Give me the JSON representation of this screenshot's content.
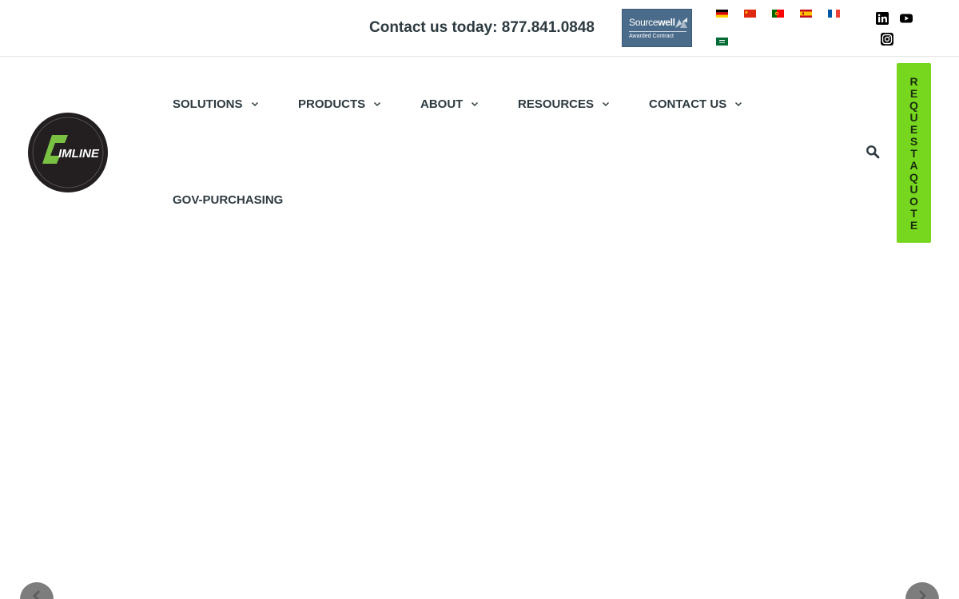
{
  "topbar": {
    "contact_text": "Contact us today: 877.841.0848",
    "sourcewell": {
      "name_light": "Source",
      "name_bold": "well",
      "subtitle": "Awarded Contract"
    },
    "flags": [
      "german-flag",
      "chinese-flag",
      "portuguese-flag",
      "spanish-flag",
      "french-flag",
      "saudi-flag"
    ],
    "social": [
      "linkedin-icon",
      "youtube-icon",
      "instagram-icon"
    ]
  },
  "logo": {
    "text": "IMLINE",
    "accent_color": "#7ac143",
    "disc_color": "#231f20"
  },
  "nav": {
    "items": [
      {
        "label": "SOLUTIONS",
        "has_dropdown": true
      },
      {
        "label": "PRODUCTS",
        "has_dropdown": true
      },
      {
        "label": "ABOUT",
        "has_dropdown": true
      },
      {
        "label": "RESOURCES",
        "has_dropdown": true
      },
      {
        "label": "CONTACT US",
        "has_dropdown": true
      },
      {
        "label": "GOV-PURCHASING",
        "has_dropdown": false
      }
    ],
    "search_icon": "search-icon"
  },
  "quote_button": {
    "letters": [
      "R",
      "E",
      "Q",
      "U",
      "E",
      "S",
      "T",
      "A",
      "Q",
      "U",
      "O",
      "T",
      "E"
    ],
    "color": "#77d71e"
  },
  "slider": {
    "prev_icon": "chevron-left-icon",
    "next_icon": "chevron-right-icon"
  }
}
